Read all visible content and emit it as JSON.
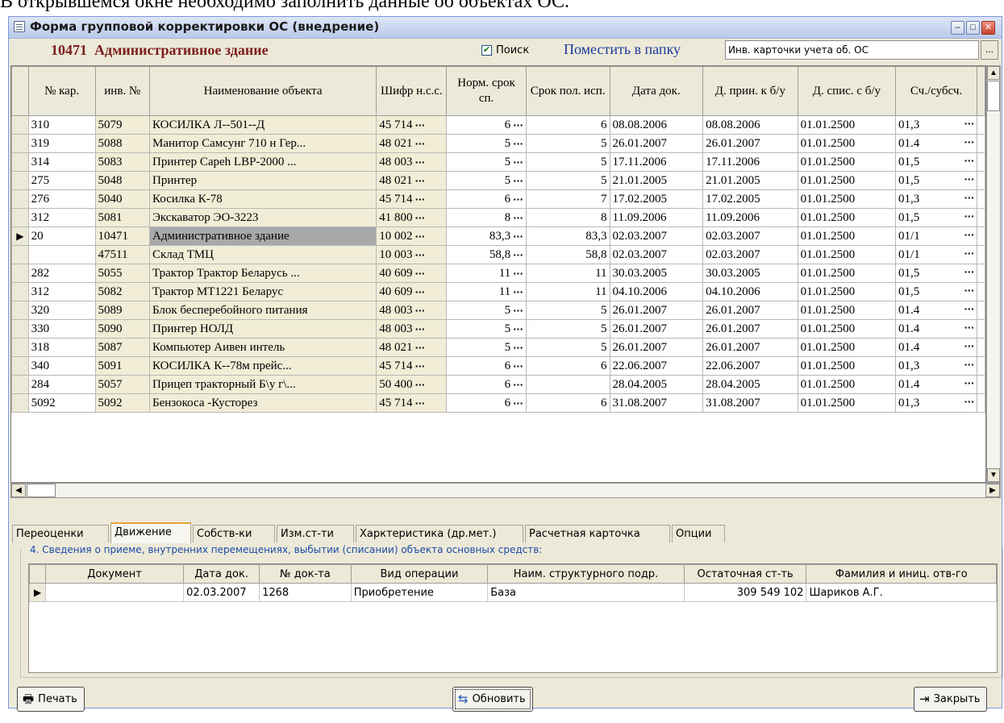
{
  "doc_text": "В открывшемся окне необходимо заполнить данные об объектах ОС.",
  "window": {
    "title": "Форма групповой корректировки ОС (внедрение)",
    "controls": {
      "minimize": "–",
      "maximize": "□",
      "close": "✕"
    }
  },
  "header": {
    "object_title": "10471  Административное здание",
    "search_label": "Поиск",
    "search_checked": "✔",
    "folder_link": "Поместить в папку",
    "folder_value": "Инв. карточки учета об. ОС",
    "folder_button": "..."
  },
  "main_grid": {
    "columns": [
      "№ кар.",
      "инв. №",
      "Наименование объекта",
      "Шифр н.с.с.",
      "Норм. срок сп.",
      "Срок пол. исп.",
      "Дата док.",
      "Д. прин. к б/у",
      "Д. спис. с б/у",
      "Сч./субсч."
    ],
    "rows": [
      {
        "card": "310",
        "inv": "5079",
        "name": "   КОСИЛКА    Л--501--Д",
        "code": "45 714",
        "norm": "6",
        "term": "6",
        "date": "08.08.2006",
        "accept": "08.08.2006",
        "writeoff": "01.01.2500",
        "acc": "01,3"
      },
      {
        "card": "319",
        "inv": "5088",
        "name": "Манитор Самсунг 710 н Гер...",
        "code": "48 021",
        "norm": "5",
        "term": "5",
        "date": "26.01.2007",
        "accept": "26.01.2007",
        "writeoff": "01.01.2500",
        "acc": "01.4"
      },
      {
        "card": "314",
        "inv": "5083",
        "name": "Принтер Capeh LBP-2000 ...",
        "code": "48 003",
        "norm": "5",
        "term": "5",
        "date": "17.11.2006",
        "accept": "17.11.2006",
        "writeoff": "01.01.2500",
        "acc": "01,5"
      },
      {
        "card": "275",
        "inv": "5048",
        "name": "Принтер",
        "code": "48 021",
        "norm": "5",
        "term": "5",
        "date": "21.01.2005",
        "accept": "21.01.2005",
        "writeoff": "01.01.2500",
        "acc": "01,5"
      },
      {
        "card": "276",
        "inv": "5040",
        "name": "Косилка К-78",
        "code": "45 714",
        "norm": "6",
        "term": "7",
        "date": "17.02.2005",
        "accept": "17.02.2005",
        "writeoff": "01.01.2500",
        "acc": "01,3"
      },
      {
        "card": "312",
        "inv": "5081",
        "name": "Экскаватор ЭО-3223",
        "code": "41 800",
        "norm": "8",
        "term": "8",
        "date": "11.09.2006",
        "accept": "11.09.2006",
        "writeoff": "01.01.2500",
        "acc": "01,5"
      },
      {
        "card": "20",
        "inv": "10471",
        "name": "Административное здание",
        "code": "10 002",
        "norm": "83,3",
        "term": "83,3",
        "date": "02.03.2007",
        "accept": "02.03.2007",
        "writeoff": "01.01.2500",
        "acc": "01/1",
        "current": true
      },
      {
        "card": "",
        "inv": "47511",
        "name": "Склад ТМЦ",
        "code": "10 003",
        "norm": "58,8",
        "term": "58,8",
        "date": "02.03.2007",
        "accept": "02.03.2007",
        "writeoff": "01.01.2500",
        "acc": "01/1"
      },
      {
        "card": "282",
        "inv": "5055",
        "name": "Трактор   Трактор Беларусь ...",
        "code": "40 609",
        "norm": "11",
        "term": "11",
        "date": "30.03.2005",
        "accept": "30.03.2005",
        "writeoff": "01.01.2500",
        "acc": "01,5"
      },
      {
        "card": "312",
        "inv": "5082",
        "name": "Трактор МТ1221  Беларус",
        "code": "40 609",
        "norm": "11",
        "term": "11",
        "date": "04.10.2006",
        "accept": "04.10.2006",
        "writeoff": "01.01.2500",
        "acc": "01,5"
      },
      {
        "card": "320",
        "inv": "5089",
        "name": "Блок бесперебойного питания",
        "code": "48 003",
        "norm": "5",
        "term": "5",
        "date": "26.01.2007",
        "accept": "26.01.2007",
        "writeoff": "01.01.2500",
        "acc": "01.4"
      },
      {
        "card": "330",
        "inv": "5090",
        "name": "Принтер НОЛД",
        "code": "48 003",
        "norm": "5",
        "term": "5",
        "date": "26.01.2007",
        "accept": "26.01.2007",
        "writeoff": "01.01.2500",
        "acc": "01.4"
      },
      {
        "card": "318",
        "inv": "5087",
        "name": "Компьютер   Аивен интель",
        "code": "48 021",
        "norm": "5",
        "term": "5",
        "date": "26.01.2007",
        "accept": "26.01.2007",
        "writeoff": "01.01.2500",
        "acc": "01.4"
      },
      {
        "card": "340",
        "inv": "5091",
        "name": "   КОСИЛКА   К--78м прейс...",
        "code": "45 714",
        "norm": "6",
        "term": "6",
        "date": "22.06.2007",
        "accept": "22.06.2007",
        "writeoff": "01.01.2500",
        "acc": "01,3"
      },
      {
        "card": "284",
        "inv": "5057",
        "name": "Прицеп  тракторный  Б\\у г\\...",
        "code": "50 400",
        "norm": "6",
        "term": "",
        "date": "28.04.2005",
        "accept": "28.04.2005",
        "writeoff": "01.01.2500",
        "acc": "01.4"
      },
      {
        "card": "5092",
        "inv": "5092",
        "name": "Бензокоса -Кусторез",
        "code": "45 714",
        "norm": "6",
        "term": "6",
        "date": "31.08.2007",
        "accept": "31.08.2007",
        "writeoff": "01.01.2500",
        "acc": "01,3"
      }
    ]
  },
  "tabs": [
    "Переоценки",
    "Движение",
    "Собств-ки",
    "Изм.ст-ти",
    "Харктеристика (др.мет.)",
    "Расчетная карточка",
    "Опции"
  ],
  "active_tab": "Движение",
  "movement": {
    "group_title": "4. Сведения о приеме, внутренних перемещениях, выбытии (списании) объекта основных средств:",
    "columns": [
      "Документ",
      "Дата док.",
      "№ док-та",
      "Вид операции",
      "Наим. структурного подр.",
      "Остаточная ст-ть",
      "Фамилия и иниц. отв-го"
    ],
    "rows": [
      {
        "doc": "",
        "date": "02.03.2007",
        "num": "1268",
        "op": "Приобретение",
        "dept": "База",
        "residual": "309 549 102",
        "person": "Шариков А.Г."
      }
    ]
  },
  "buttons": {
    "print": "Печать",
    "refresh": "Обновить",
    "close": "Закрыть"
  },
  "icons": {
    "row_indicator": "▶",
    "ellipsis": "···"
  }
}
